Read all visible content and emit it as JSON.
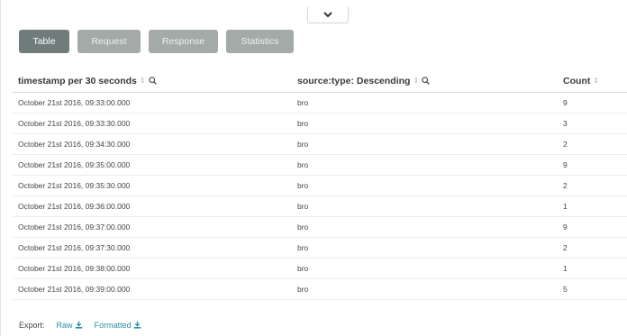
{
  "tabs": {
    "table_label": "Table",
    "request_label": "Request",
    "response_label": "Response",
    "statistics_label": "Statistics",
    "active": "Table"
  },
  "table": {
    "headers": {
      "timestamp": "timestamp per 30 seconds",
      "source": "source:type: Descending",
      "count": "Count"
    },
    "rows": [
      {
        "timestamp": "October 21st 2016, 09:33:00.000",
        "source": "bro",
        "count": "9"
      },
      {
        "timestamp": "October 21st 2016, 09:33:30.000",
        "source": "bro",
        "count": "3"
      },
      {
        "timestamp": "October 21st 2016, 09:34:30.000",
        "source": "bro",
        "count": "2"
      },
      {
        "timestamp": "October 21st 2016, 09:35:00.000",
        "source": "bro",
        "count": "9"
      },
      {
        "timestamp": "October 21st 2016, 09:35:30.000",
        "source": "bro",
        "count": "2"
      },
      {
        "timestamp": "October 21st 2016, 09:36:00.000",
        "source": "bro",
        "count": "1"
      },
      {
        "timestamp": "October 21st 2016, 09:37:00.000",
        "source": "bro",
        "count": "9"
      },
      {
        "timestamp": "October 21st 2016, 09:37:30.000",
        "source": "bro",
        "count": "2"
      },
      {
        "timestamp": "October 21st 2016, 09:38:00.000",
        "source": "bro",
        "count": "1"
      },
      {
        "timestamp": "October 21st 2016, 09:39:00.000",
        "source": "bro",
        "count": "5"
      }
    ]
  },
  "export": {
    "label": "Export:",
    "raw_label": "Raw",
    "formatted_label": "Formatted"
  },
  "colors": {
    "active_tab": "#6f7c7a",
    "inactive_tab": "#a3aaa8",
    "link": "#2a8ea6"
  },
  "icons": [
    "chevron-down-icon",
    "sort-icon",
    "magnifier-icon",
    "download-icon"
  ]
}
